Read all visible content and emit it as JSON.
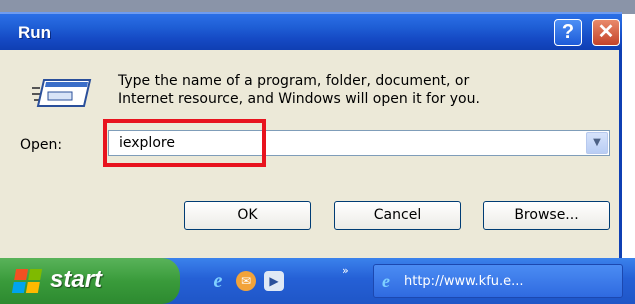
{
  "window": {
    "title": "Run",
    "help_glyph": "?",
    "close_glyph": "✕",
    "accent_color": "#1f5fd6",
    "icons": [
      "help-icon",
      "close-icon"
    ]
  },
  "dialog": {
    "icon": "run-program-icon",
    "description_line1": "Type the name of a program, folder, document, or",
    "description_line2": "Internet resource, and Windows will open it for you.",
    "open_label": "Open:",
    "open_value": "iexplore",
    "dropdown_icon": "chevron-down-icon",
    "highlight_color": "#e8131e",
    "ok_label": "OK",
    "cancel_label": "Cancel",
    "browse_label": "Browse..."
  },
  "taskbar": {
    "start_label": "start",
    "start_icon": "windows-logo-icon",
    "quick_launch_icons": [
      "internet-explorer-icon",
      "outlook-express-icon",
      "media-player-icon"
    ],
    "more_glyph": "»",
    "task_icon": "internet-explorer-icon",
    "task_label": "http://www.kfu.e..."
  }
}
